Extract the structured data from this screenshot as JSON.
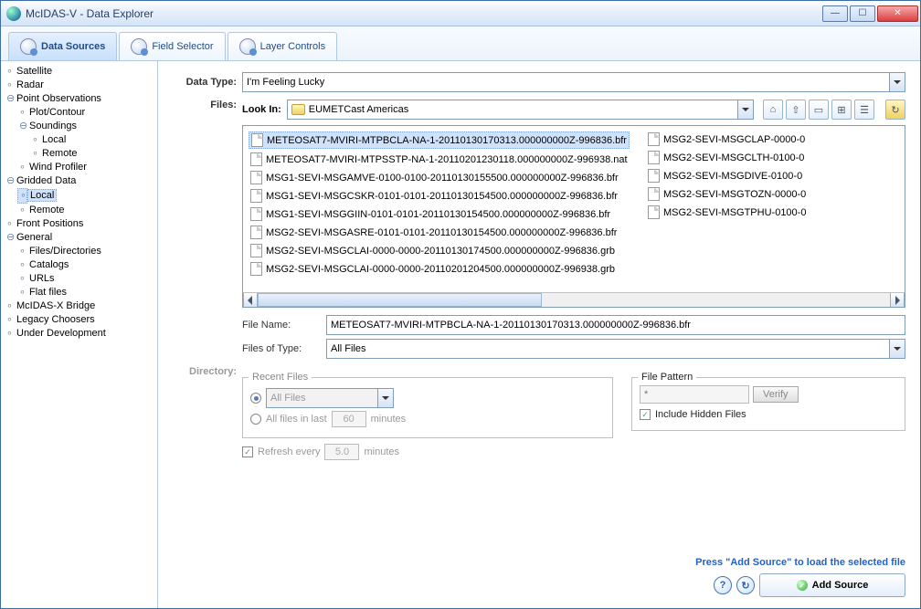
{
  "titlebar": {
    "title": "McIDAS-V - Data Explorer"
  },
  "tabs": [
    {
      "label": "Data Sources",
      "active": true
    },
    {
      "label": "Field Selector",
      "active": false
    },
    {
      "label": "Layer Controls",
      "active": false
    }
  ],
  "tree": [
    {
      "label": "Satellite"
    },
    {
      "label": "Radar"
    },
    {
      "label": "Point Observations",
      "children": [
        {
          "label": "Plot/Contour"
        },
        {
          "label": "Soundings",
          "children": [
            {
              "label": "Local"
            },
            {
              "label": "Remote"
            }
          ]
        },
        {
          "label": "Wind Profiler"
        }
      ]
    },
    {
      "label": "Gridded Data",
      "children": [
        {
          "label": "Local",
          "selected": true
        },
        {
          "label": "Remote"
        }
      ]
    },
    {
      "label": "Front Positions"
    },
    {
      "label": "General",
      "children": [
        {
          "label": "Files/Directories"
        },
        {
          "label": "Catalogs"
        },
        {
          "label": "URLs"
        },
        {
          "label": "Flat files"
        }
      ]
    },
    {
      "label": "McIDAS-X Bridge"
    },
    {
      "label": "Legacy Choosers"
    },
    {
      "label": "Under Development"
    }
  ],
  "dataType": {
    "label": "Data Type:",
    "value": "I'm Feeling Lucky"
  },
  "filesLabel": "Files:",
  "lookIn": {
    "label": "Look In:",
    "value": "EUMETCast Americas"
  },
  "fileList": {
    "col1": [
      "METEOSAT7-MVIRI-MTPBCLA-NA-1-20110130170313.000000000Z-996836.bfr",
      "METEOSAT7-MVIRI-MTPSSTP-NA-1-20110201230118.000000000Z-996938.nat",
      "MSG1-SEVI-MSGAMVE-0100-0100-20110130155500.000000000Z-996836.bfr",
      "MSG1-SEVI-MSGCSKR-0101-0101-20110130154500.000000000Z-996836.bfr",
      "MSG1-SEVI-MSGGIIN-0101-0101-20110130154500.000000000Z-996836.bfr",
      "MSG2-SEVI-MSGASRE-0101-0101-20110130154500.000000000Z-996836.bfr",
      "MSG2-SEVI-MSGCLAI-0000-0000-20110130174500.000000000Z-996836.grb",
      "MSG2-SEVI-MSGCLAI-0000-0000-20110201204500.000000000Z-996938.grb"
    ],
    "col2": [
      "MSG2-SEVI-MSGCLAP-0000-0",
      "MSG2-SEVI-MSGCLTH-0100-0",
      "MSG2-SEVI-MSGDIVE-0100-0",
      "MSG2-SEVI-MSGTOZN-0000-0",
      "MSG2-SEVI-MSGTPHU-0100-0"
    ],
    "selectedIndex": 0
  },
  "fileName": {
    "label": "File Name:",
    "value": "METEOSAT7-MVIRI-MTPBCLA-NA-1-20110130170313.000000000Z-996836.bfr"
  },
  "filesOfType": {
    "label": "Files of Type:",
    "value": "All Files"
  },
  "directoryLabel": "Directory:",
  "recentFiles": {
    "legend": "Recent Files",
    "allFilesRadio": "All Files",
    "allInLastPrefix": "All files in last",
    "minutesSuffix": "minutes",
    "lastValue": "60"
  },
  "refresh": {
    "label": "Refresh every",
    "value": "5.0",
    "suffix": "minutes"
  },
  "filePattern": {
    "legend": "File Pattern",
    "placeholder": "*",
    "verify": "Verify",
    "includeHidden": "Include Hidden Files"
  },
  "hint": "Press \"Add Source\" to load the selected file",
  "addSource": "Add Source"
}
